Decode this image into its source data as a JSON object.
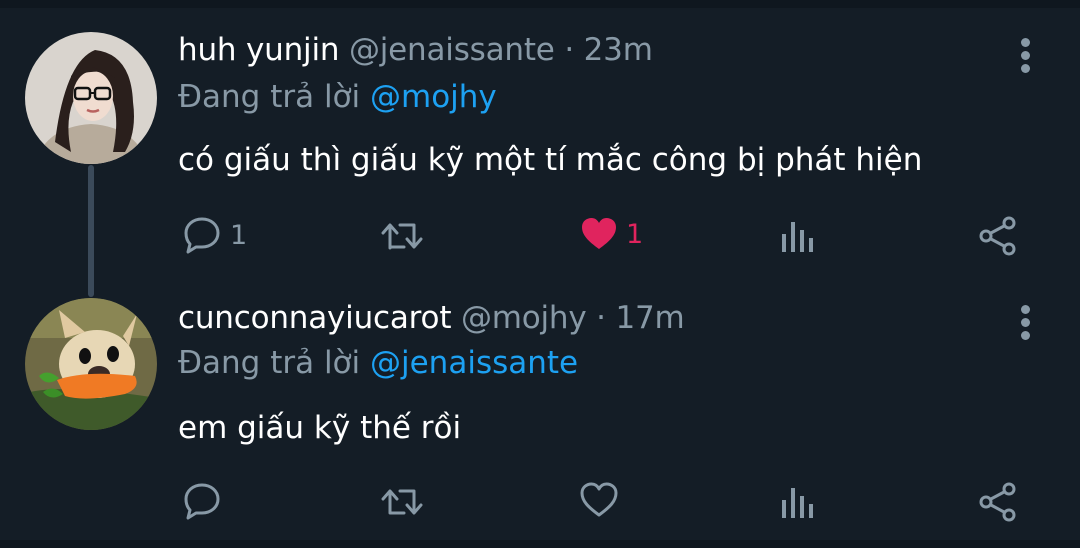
{
  "tweets": [
    {
      "name": "huh yunjin",
      "handle": "@jenaissante",
      "separator": "·",
      "time": "23m",
      "replying_prefix": "Đang trả lời",
      "replying_to": "@mojhy",
      "text": "có giấu thì giấu kỹ một tí mắc công bị phát hiện",
      "replies": "1",
      "likes": "1",
      "liked": true,
      "avatar_icon": "woman-glasses-avatar"
    },
    {
      "name": "cunconnayiucarot",
      "handle": "@mojhy",
      "separator": "·",
      "time": "17m",
      "replying_prefix": "Đang trả lời",
      "replying_to": "@jenaissante",
      "text": "em giấu kỹ thế rồi",
      "replies": "",
      "likes": "",
      "liked": false,
      "avatar_icon": "puppy-with-carrot-avatar"
    }
  ],
  "colors": {
    "background": "#141d26",
    "secondary_text": "#8899a6",
    "mention": "#1da1f2",
    "like": "#e0245e"
  },
  "icons": [
    "reply-icon",
    "retweet-icon",
    "like-icon",
    "analytics-icon",
    "share-icon",
    "more-icon"
  ]
}
